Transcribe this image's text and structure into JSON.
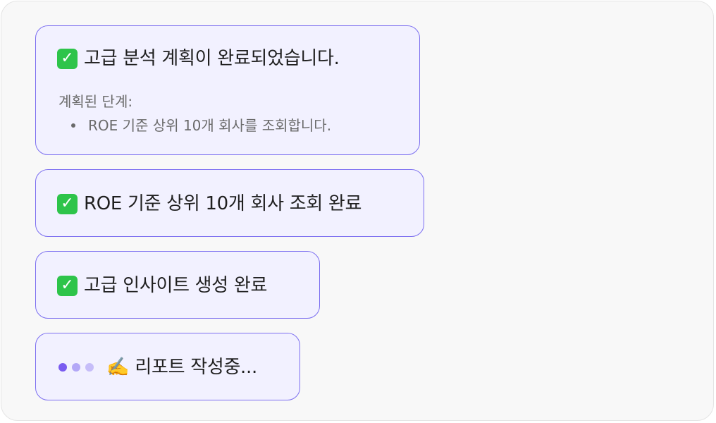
{
  "colors": {
    "card_background": "#f2f1ff",
    "card_border": "#7c6ff0",
    "check_green": "#2ec44a",
    "dot_active": "#7a5cf0",
    "dot_inactive": "#b3a8f7"
  },
  "plan_card": {
    "icon": "check-mark-icon",
    "title": "고급 분석 계획이 완료되었습니다.",
    "steps_label": "계획된 단계:",
    "steps": [
      {
        "text": "ROE 기준 상위 10개 회사를 조회합니다."
      }
    ]
  },
  "query_card": {
    "icon": "check-mark-icon",
    "title": "ROE 기준 상위 10개 회사 조회 완료"
  },
  "insight_card": {
    "icon": "check-mark-icon",
    "title": "고급 인사이트 생성 완료"
  },
  "report_card": {
    "icon": "writing-hand-icon",
    "icon_glyph": "✍️",
    "loading_icon": "loading-dots-icon",
    "title": "리포트 작성중..."
  }
}
